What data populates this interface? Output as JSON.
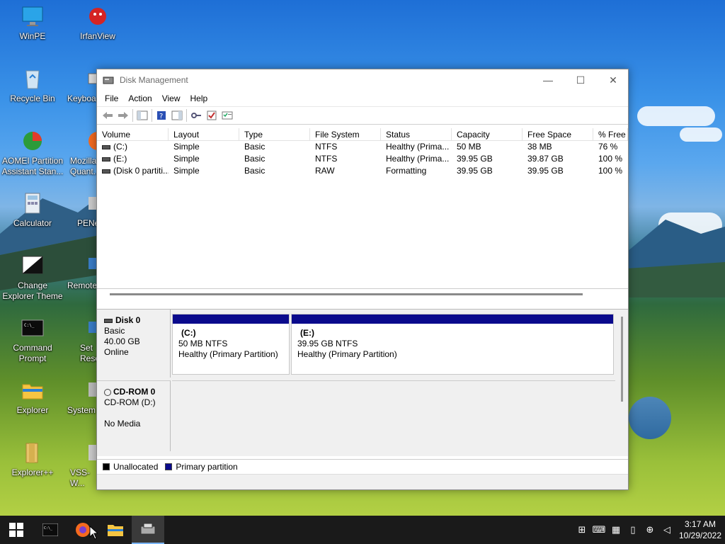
{
  "desktop": {
    "icons": [
      {
        "label": "WinPE"
      },
      {
        "label": "IrfanView"
      },
      {
        "label": "Recycle Bin"
      },
      {
        "label": "Keyboa..."
      },
      {
        "label": "AOMEI Partition Assistant Stan..."
      },
      {
        "label": "Mozilla Quant..."
      },
      {
        "label": "Calculator"
      },
      {
        "label": "PENe..."
      },
      {
        "label": "Change Explorer Theme"
      },
      {
        "label": "Remote"
      },
      {
        "label": "Command Prompt"
      },
      {
        "label": "Set Reso..."
      },
      {
        "label": "Explorer"
      },
      {
        "label": "System"
      },
      {
        "label": "Explorer++"
      },
      {
        "label": "VSS-W..."
      }
    ]
  },
  "window": {
    "title": "Disk Management",
    "controls": {
      "minimize": "—",
      "maximize": "☐",
      "close": "✕"
    },
    "menu": [
      "File",
      "Action",
      "View",
      "Help"
    ],
    "columns": [
      "Volume",
      "Layout",
      "Type",
      "File System",
      "Status",
      "Capacity",
      "Free Space",
      "% Free"
    ],
    "rows": [
      {
        "volume": "(C:)",
        "layout": "Simple",
        "type": "Basic",
        "fs": "NTFS",
        "status": "Healthy (Prima...",
        "capacity": "50 MB",
        "free": "38 MB",
        "pct": "76 %"
      },
      {
        "volume": "(E:)",
        "layout": "Simple",
        "type": "Basic",
        "fs": "NTFS",
        "status": "Healthy (Prima...",
        "capacity": "39.95 GB",
        "free": "39.87 GB",
        "pct": "100 %"
      },
      {
        "volume": "(Disk 0 partiti...",
        "layout": "Simple",
        "type": "Basic",
        "fs": "RAW",
        "status": "Formatting",
        "capacity": "39.95 GB",
        "free": "39.95 GB",
        "pct": "100 %"
      }
    ],
    "disk0": {
      "name": "Disk 0",
      "type": "Basic",
      "size": "40.00 GB",
      "state": "Online",
      "partitions": [
        {
          "name": "(C:)",
          "size": "50 MB NTFS",
          "status": "Healthy (Primary Partition)"
        },
        {
          "name": "(E:)",
          "size": "39.95 GB NTFS",
          "status": "Healthy (Primary Partition)"
        }
      ]
    },
    "cdrom": {
      "name": "CD-ROM 0",
      "type": "CD-ROM (D:)",
      "media": "No Media"
    },
    "legend": [
      {
        "label": "Unallocated",
        "color": "#000000"
      },
      {
        "label": "Primary partition",
        "color": "#0a0a8c"
      }
    ]
  },
  "taskbar": {
    "time": "3:17 AM",
    "date": "10/29/2022"
  }
}
